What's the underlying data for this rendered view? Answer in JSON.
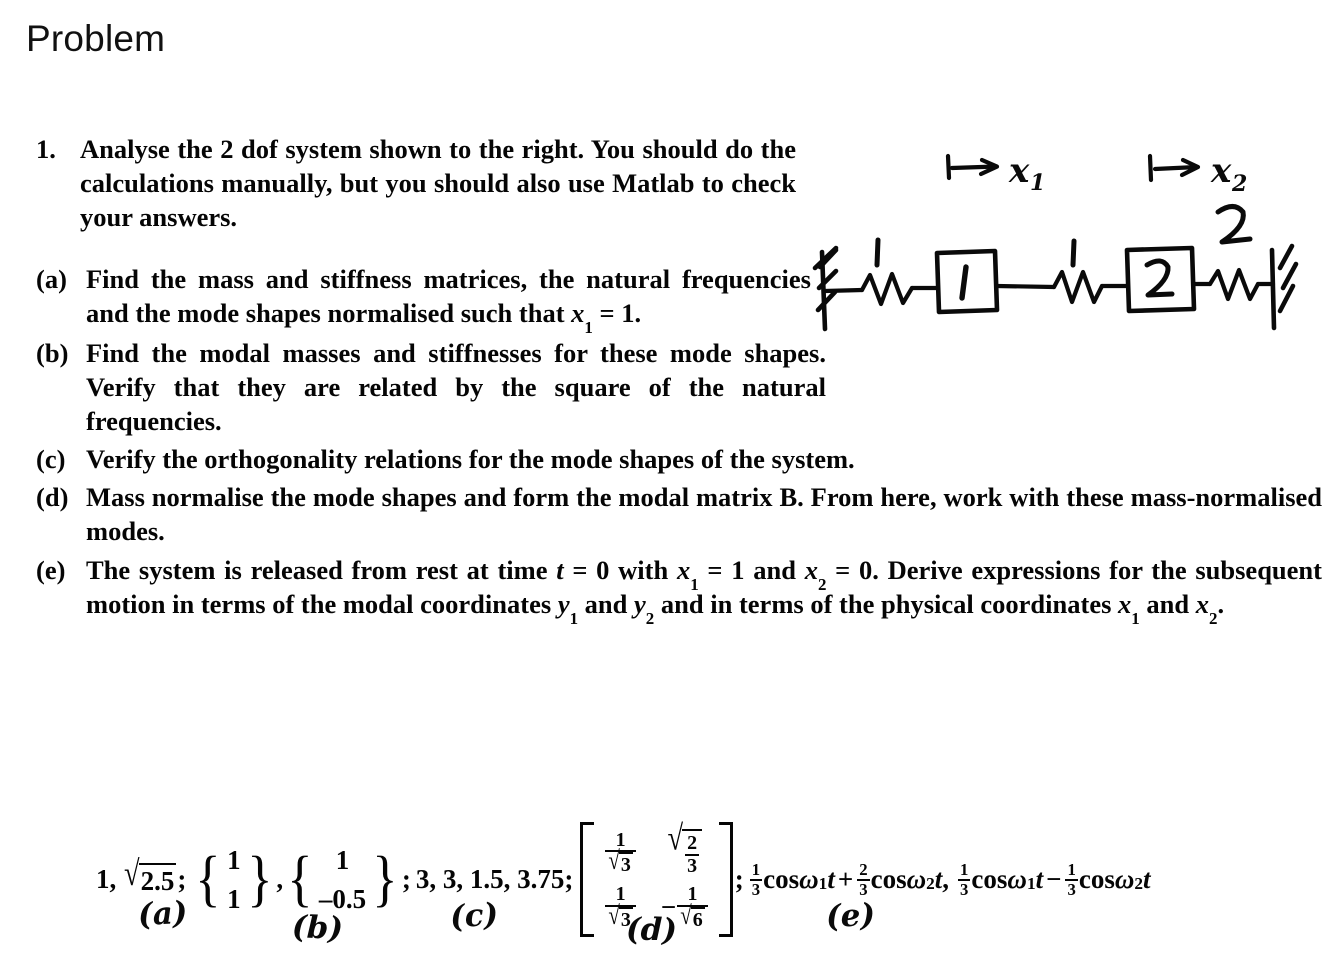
{
  "page": {
    "title": "Problem"
  },
  "question": {
    "item1": {
      "marker": "1.",
      "text": "Analyse the 2 dof system shown to the right. You should do the calculations manually, but you should also use Matlab to check your answers."
    },
    "parts": [
      {
        "marker": "(a)",
        "text_before": "Find the mass and stiffness matrices, the natural frequencies and the mode shapes normalised such that ",
        "var": "x",
        "sub": "1",
        "text_after": " = 1."
      },
      {
        "marker": "(b)",
        "text": "Find the modal masses and stiffnesses for these mode shapes.  Verify that they are related by the square of the natural frequencies."
      },
      {
        "marker": "(c)",
        "text": "Verify the orthogonality relations for the mode shapes of the system."
      },
      {
        "marker": "(d)",
        "text_1": "Mass normalise the mode shapes and form the modal matrix ",
        "matrix_symbol": "B",
        "text_2": ".  From here, work with these mass-normalised modes."
      },
      {
        "marker": "(e)",
        "text_1": "The system is released from rest at time ",
        "t_var": "t",
        "text_2": " = 0 with ",
        "x1_var": "x",
        "x1_sub": "1",
        "text_3": " = 1 and ",
        "x2_var": "x",
        "x2_sub": "2",
        "text_4": " = 0.  Derive expressions for the subsequent motion in terms of the modal coordinates ",
        "y1_var": "y",
        "y1_sub": "1",
        "text_5": " and ",
        "y2_var": "y",
        "y2_sub": "2",
        "text_6": " and in terms of the physical coordinates ",
        "x1b_var": "x",
        "x1b_sub": "1",
        "text_7": " and ",
        "x2b_var": "x",
        "x2b_sub": "2",
        "text_8": "."
      }
    ]
  },
  "figure": {
    "caption_arrows": [
      {
        "label_var": "x",
        "label_sub": "1"
      },
      {
        "label_var": "x",
        "label_sub": "2"
      }
    ],
    "springs": [
      {
        "label": "1"
      },
      {
        "label": "1"
      },
      {
        "label": "2"
      }
    ],
    "masses": [
      {
        "label": "1"
      },
      {
        "label": "2"
      }
    ],
    "walls": [
      "left-wall",
      "right-wall"
    ]
  },
  "answers": {
    "natural_frequencies": {
      "first": "1,",
      "sqrt_radical": "√",
      "sqrt_value": "2.5",
      "semicolon": ";"
    },
    "mode_shape_1": {
      "top": "1",
      "bottom": "1"
    },
    "comma": ",",
    "mode_shape_2": {
      "top": "1",
      "bottom": "–0.5"
    },
    "semicolon_2": ";",
    "modal_values": "3, 3, 1.5, 3.75;",
    "modal_matrix": {
      "r1c1_num": "1",
      "r1c1_den_radical": "√",
      "r1c1_den_val": "3",
      "r1c2_radical": "√",
      "r1c2_num": "2",
      "r1c2_den": "3",
      "r2c1_num": "1",
      "r2c1_den_radical": "√",
      "r2c1_den_val": "3",
      "r2c2_minus": "−",
      "r2c2_num": "1",
      "r2c2_den_radical": "√",
      "r2c2_den_val": "6"
    },
    "semicolon_3": ";",
    "motion": {
      "y1_f1_num": "1",
      "y1_f1_den": "3",
      "y1_t1": "cos",
      "y1_w1": "ω",
      "y1_w1_sub": "1",
      "y1_t_var1": "t",
      "y1_plus": "+",
      "y1_f2_num": "2",
      "y1_f2_den": "3",
      "y1_t2": "cos",
      "y1_w2": "ω",
      "y1_w2_sub": "2",
      "y1_t_var2": "t",
      "comma": ",",
      "y2_f1_num": "1",
      "y2_f1_den": "3",
      "y2_t1": "cos",
      "y2_w1": "ω",
      "y2_w1_sub": "1",
      "y2_t_var1": "t",
      "y2_minus": "−",
      "y2_f2_num": "1",
      "y2_f2_den": "3",
      "y2_t2": "cos",
      "y2_w2": "ω",
      "y2_w2_sub": "2",
      "y2_t_var2": "t"
    }
  },
  "hand_labels": {
    "a": "(a)",
    "b": "(b)",
    "c": "(c)",
    "d": "(d)",
    "e": "(e)"
  }
}
